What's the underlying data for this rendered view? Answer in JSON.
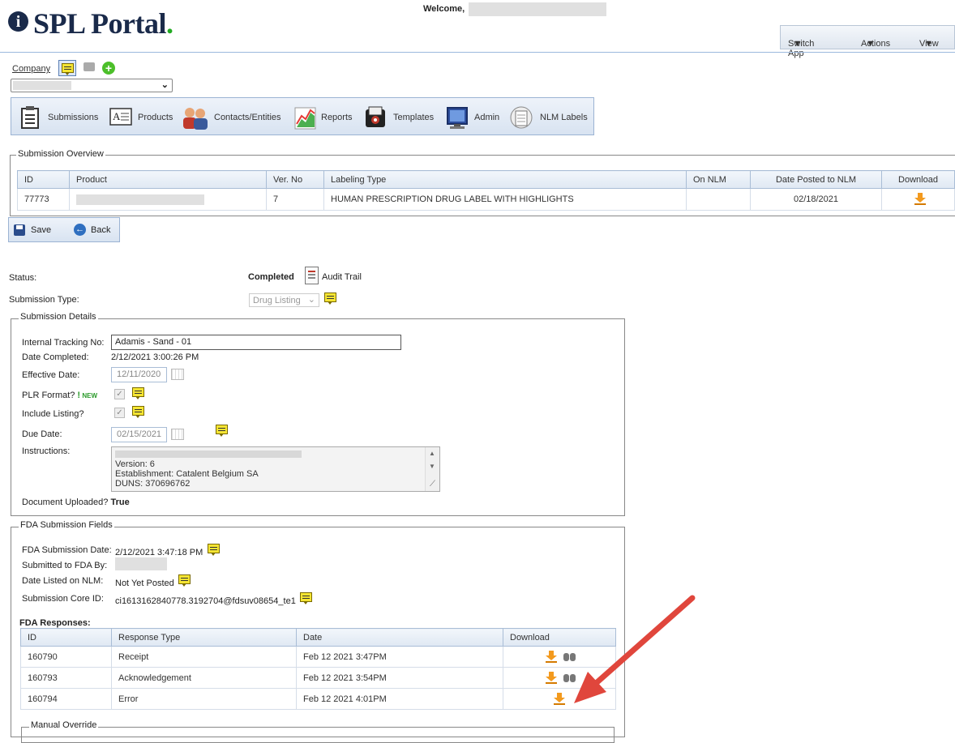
{
  "header": {
    "logo_text": "SPL Portal",
    "logo_dot": ".",
    "welcome": "Welcome,",
    "menu": [
      {
        "label": "Switch App"
      },
      {
        "label": "Actions"
      },
      {
        "label": "View"
      }
    ]
  },
  "company": {
    "link": "Company"
  },
  "toolbar": {
    "items": [
      {
        "label": "Submissions",
        "icon": "clipboard-icon"
      },
      {
        "label": "Products",
        "icon": "text-document-icon"
      },
      {
        "label": "Contacts/Entities",
        "icon": "people-icon"
      },
      {
        "label": "Reports",
        "icon": "chart-icon"
      },
      {
        "label": "Templates",
        "icon": "template-icon"
      },
      {
        "label": "Admin",
        "icon": "monitor-icon"
      },
      {
        "label": "NLM Labels",
        "icon": "nlm-labels-icon"
      }
    ]
  },
  "overview": {
    "legend": "Submission Overview",
    "columns": [
      "ID",
      "Product",
      "Ver. No",
      "Labeling Type",
      "On NLM",
      "Date Posted to NLM",
      "Download"
    ],
    "row": {
      "id": "77773",
      "version": "7",
      "labeling_type": "HUMAN PRESCRIPTION DRUG LABEL WITH HIGHLIGHTS",
      "on_nlm": "",
      "date_posted": "02/18/2021"
    }
  },
  "actions": {
    "save": "Save",
    "back": "Back"
  },
  "status": {
    "label": "Status:",
    "value": "Completed",
    "audit_trail": "Audit Trail",
    "type_label": "Submission Type:",
    "type_value": "Drug Listing"
  },
  "details": {
    "legend": "Submission Details",
    "tracking_label": "Internal Tracking No:",
    "tracking_value": "Adamis - Sand - 01",
    "date_completed_label": "Date Completed:",
    "date_completed_value": "2/12/2021 3:00:26 PM",
    "effective_label": "Effective Date:",
    "effective_value": "12/11/2020",
    "plr_label": "PLR Format?",
    "plr_badge": "NEW",
    "include_label": "Include Listing?",
    "due_label": "Due Date:",
    "due_value": "02/15/2021",
    "instructions_label": "Instructions:",
    "instructions_lines": [
      "Version: 6",
      "Establishment: Catalent Belgium SA",
      "DUNS: 370696762"
    ],
    "doc_uploaded_label": "Document Uploaded?",
    "doc_uploaded_value": "True"
  },
  "fda": {
    "legend": "FDA Submission Fields",
    "submission_date_label": "FDA Submission Date:",
    "submission_date_value": "2/12/2021 3:47:18 PM",
    "submitted_by_label": "Submitted to FDA By:",
    "date_listed_label": "Date Listed on NLM:",
    "date_listed_value": "Not Yet Posted",
    "core_id_label": "Submission Core ID:",
    "core_id_value": "ci1613162840778.3192704@fdsuv08654_te1",
    "responses_title": "FDA Responses:",
    "columns": [
      "ID",
      "Response Type",
      "Date",
      "Download"
    ],
    "rows": [
      {
        "id": "160790",
        "type": "Receipt",
        "date": "Feb 12 2021 3:47PM"
      },
      {
        "id": "160793",
        "type": "Acknowledgement",
        "date": "Feb 12 2021 3:54PM"
      },
      {
        "id": "160794",
        "type": "Error",
        "date": "Feb 12 2021 4:01PM"
      }
    ]
  },
  "manual_override": {
    "legend": "Manual Override"
  },
  "colors": {
    "brand": "#1a2a4a",
    "accent_dot": "#22aa22",
    "annotation_arrow": "#e0463c"
  }
}
